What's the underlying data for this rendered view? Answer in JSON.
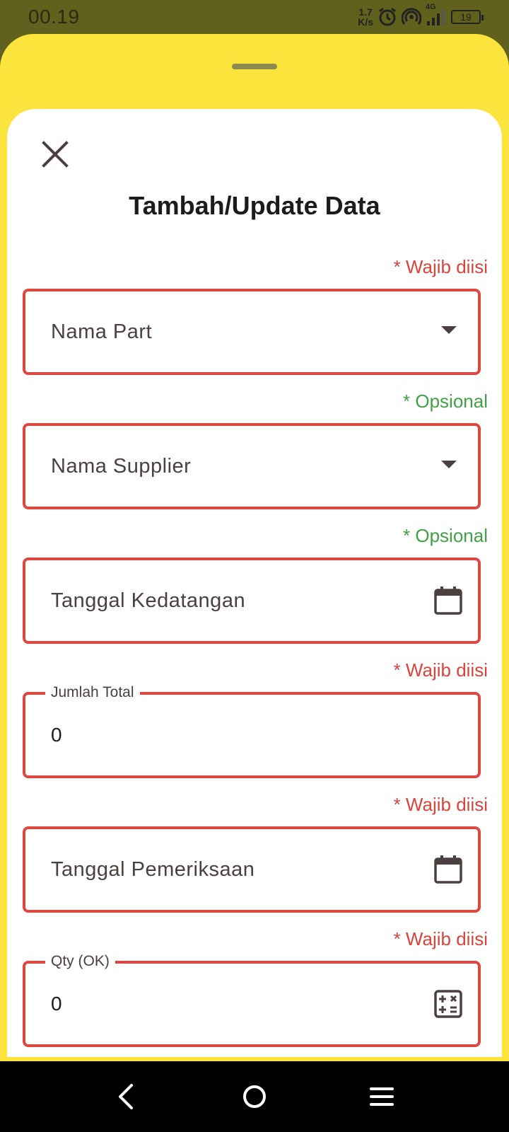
{
  "status_bar": {
    "time": "00.19",
    "net_speed_value": "1.7",
    "net_speed_unit": "K/s",
    "network_type": "4G",
    "battery_level": "19"
  },
  "dialog": {
    "title": "Tambah/Update Data"
  },
  "fields": [
    {
      "requirement": "* Wajib diisi",
      "placeholder": "Nama Part"
    },
    {
      "requirement": "* Opsional",
      "placeholder": "Nama Supplier"
    },
    {
      "requirement": "* Opsional",
      "placeholder": "Tanggal Kedatangan"
    },
    {
      "requirement": "* Wajib diisi",
      "label": "Jumlah Total",
      "value": "0"
    },
    {
      "requirement": "* Wajib diisi",
      "placeholder": "Tanggal Pemeriksaan"
    },
    {
      "requirement": "* Wajib diisi",
      "label": "Qty (OK)",
      "value": "0"
    }
  ],
  "colors": {
    "status_bg": "#5f611d",
    "sheet_bg": "#fbe53c",
    "required": "#d9443c",
    "optional": "#43a047",
    "field_border": "#dc4740"
  }
}
